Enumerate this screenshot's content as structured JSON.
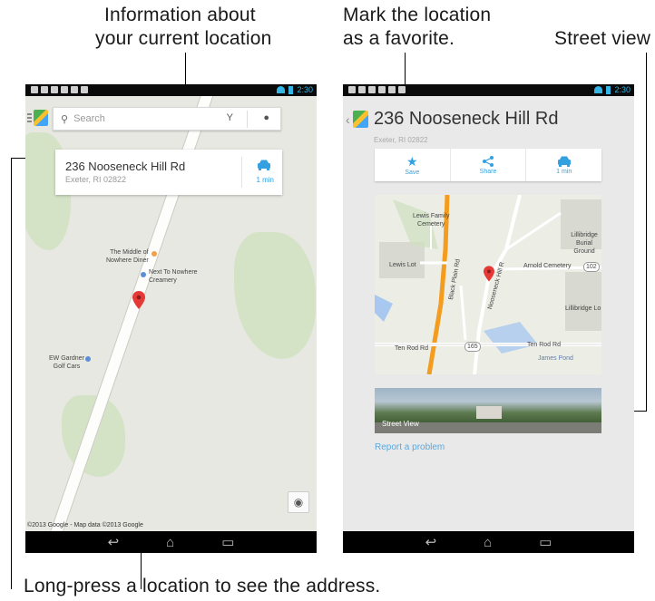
{
  "callouts": {
    "info_line1": "Information about",
    "info_line2": "your current location",
    "fav_line1": "Mark the location",
    "fav_line2": "as a favorite.",
    "street": "Street view",
    "longpress": "Long-press a location to see the address."
  },
  "status_bar": {
    "time": "2:30"
  },
  "left_screen": {
    "search": {
      "placeholder": "Search"
    },
    "address_card": {
      "street": "236 Nooseneck Hill Rd",
      "city": "Exeter, RI 02822",
      "drive_time": "1 min"
    },
    "pois": [
      "The Middle of",
      "Nowhere Diner",
      "Next To Nowhere",
      "Creamery",
      "EW Gardner",
      "Golf Cars"
    ],
    "copyright": "©2013 Google - Map data ©2013 Google"
  },
  "right_screen": {
    "title": "236 Nooseneck Hill Rd",
    "subtitle": "Exeter, RI 02822",
    "actions": [
      {
        "label": "Save",
        "icon": "star-icon"
      },
      {
        "label": "Share",
        "icon": "share-icon"
      },
      {
        "label": "1 min",
        "icon": "car-icon"
      }
    ],
    "map_labels": {
      "lewis_family": "Lewis Family",
      "cemetery": "Cemetery",
      "lillibridge": "Lillibridge",
      "burial_ground": "Burial Ground",
      "lewis_lot": "Lewis Lot",
      "arnold": "Arnold Cemetery",
      "lillibridge_lo": "Lillibridge Lo",
      "black_plain": "Black Plain Rd",
      "nooseneck": "Nooseneck Hill R",
      "ten_rod_left": "Ten Rod Rd",
      "ten_rod_right": "Ten Rod Rd",
      "james_pond": "James Pond",
      "route_102": "102",
      "route_165": "165"
    },
    "street_view_label": "Street View",
    "report_link": "Report a problem"
  },
  "colors": {
    "accent": "#33a0e0",
    "pin": "#e53935"
  }
}
